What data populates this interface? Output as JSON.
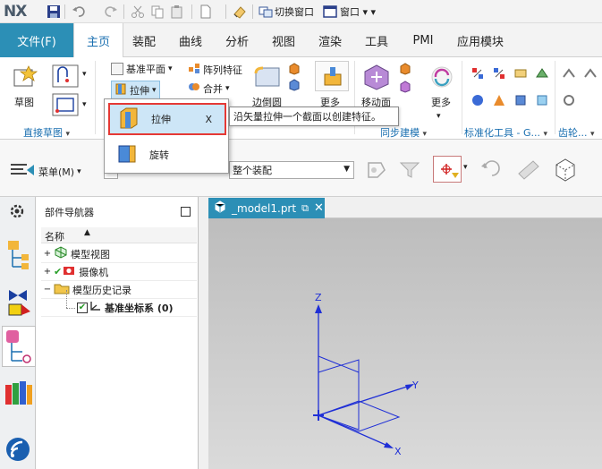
{
  "app": {
    "logo": "NX"
  },
  "quick_access": {
    "switch_window": "切换窗口",
    "window": "窗口"
  },
  "tabs": {
    "file": "文件(F)",
    "items": [
      "主页",
      "装配",
      "曲线",
      "分析",
      "视图",
      "渲染",
      "工具",
      "PMI",
      "应用模块"
    ],
    "active": "主页"
  },
  "ribbon": {
    "sketch": "草图",
    "datum_plane": "基准平面",
    "pattern_feature": "阵列特征",
    "extrude": "拉伸",
    "unite": "合并",
    "edge_blend": "边倒圆",
    "more1": "更多",
    "move_face": "移动面",
    "more2": "更多",
    "groups": {
      "direct_sketch": "直接草图",
      "sync_modeling": "同步建模",
      "std_tools": "标准化工具 - G...",
      "gear": "齿轮..."
    }
  },
  "toolbar2": {
    "menu": "菜单(M)",
    "assembly_filter": "整个装配"
  },
  "dropdown": {
    "extrude": "拉伸",
    "extrude_shortcut": "X",
    "revolve": "旋转"
  },
  "tooltip": "沿矢量拉伸一个截面以创建特征。",
  "navigator": {
    "title": "部件导航器",
    "column": "名称",
    "items": [
      "模型视图",
      "摄像机",
      "模型历史记录",
      "基准坐标系 (0)"
    ]
  },
  "graphics": {
    "tab": "_model1.prt",
    "axes": {
      "x": "X",
      "y": "Y",
      "z": "Z"
    }
  },
  "colors": {
    "accent": "#2c8fb6",
    "highlight_border": "#e53935",
    "axis": "#1f2fd6"
  }
}
